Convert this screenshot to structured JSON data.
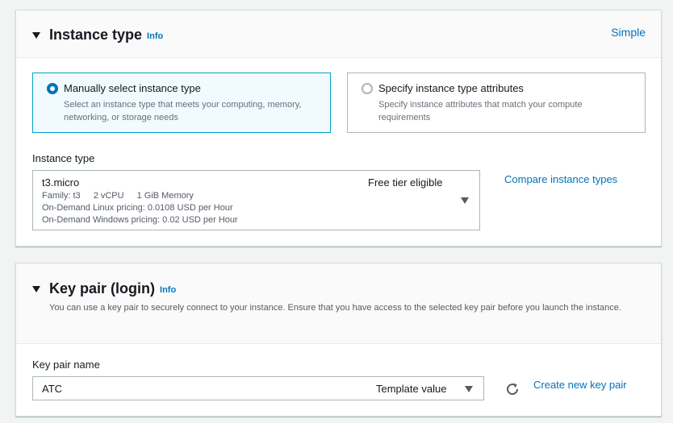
{
  "instance_type_section": {
    "title": "Instance type",
    "info_label": "Info",
    "simple_label": "Simple",
    "tiles": [
      {
        "title": "Manually select instance type",
        "description": "Select an instance type that meets your computing, memory, networking, or storage needs",
        "selected": true
      },
      {
        "title": "Specify instance type attributes",
        "description": "Specify instance attributes that match your compute requirements",
        "selected": false
      }
    ],
    "field_label": "Instance type",
    "select": {
      "value": "t3.micro",
      "badge": "Free tier eligible",
      "family": "Family: t3",
      "vcpu": "2 vCPU",
      "memory": "1 GiB Memory",
      "linux_pricing": "On-Demand Linux pricing: 0.0108 USD per Hour",
      "windows_pricing": "On-Demand Windows pricing: 0.02 USD per Hour"
    },
    "compare_link": "Compare instance types"
  },
  "key_pair_section": {
    "title": "Key pair (login)",
    "info_label": "Info",
    "description": "You can use a key pair to securely connect to your instance. Ensure that you have access to the selected key pair before you launch the instance.",
    "field_label": "Key pair name",
    "select": {
      "value": "ATC",
      "tag": "Template value"
    },
    "create_link": "Create new key pair"
  },
  "colors": {
    "link": "#0073bb",
    "selected_tile_border": "#00a1c9",
    "selected_tile_background": "#f1faff",
    "page_background": "#f2f3f3"
  }
}
